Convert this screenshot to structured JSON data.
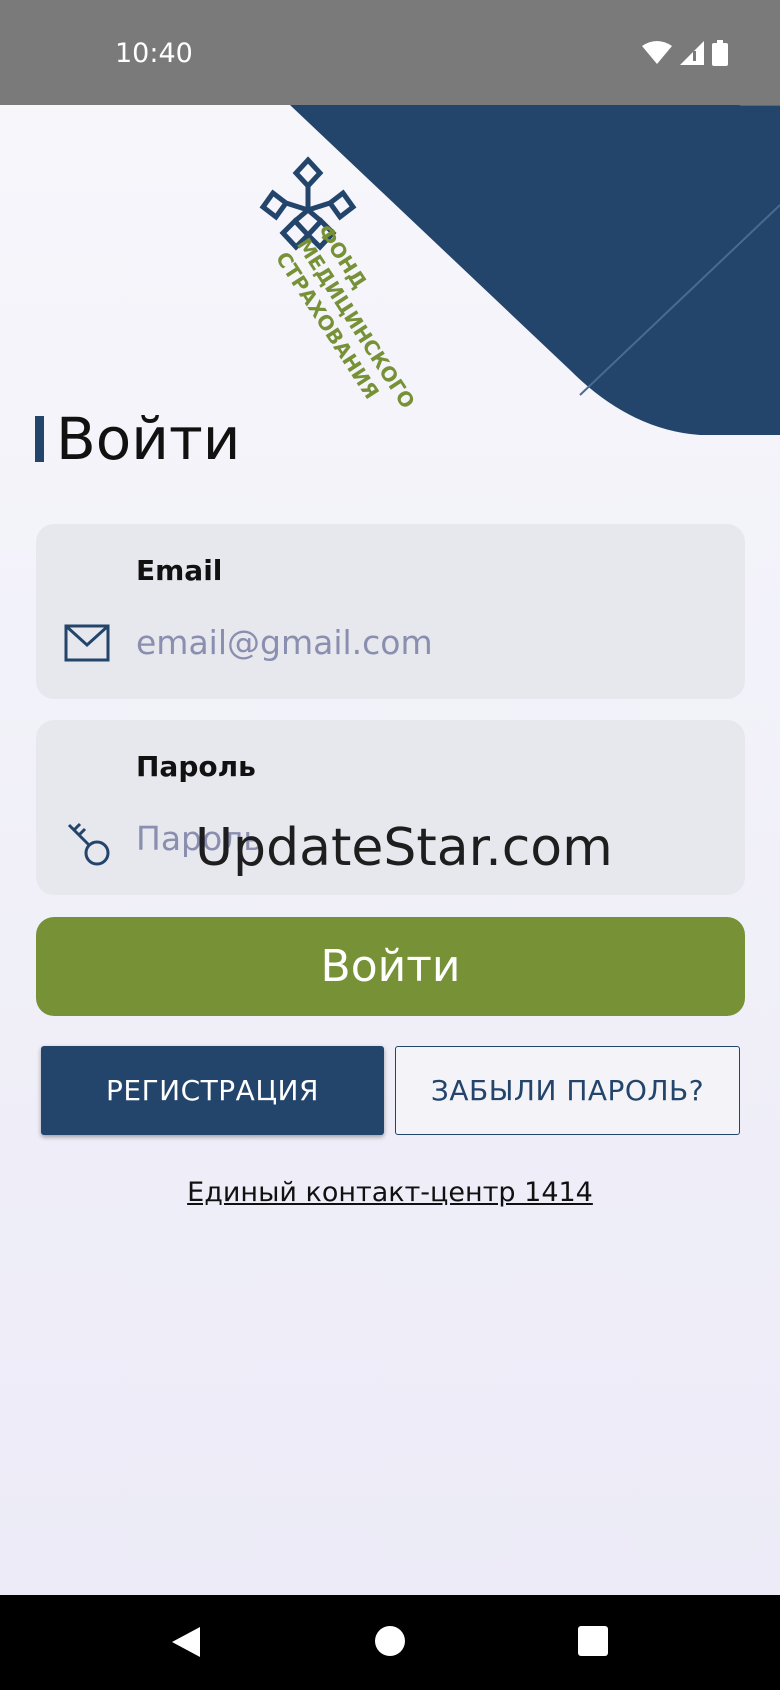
{
  "status_bar": {
    "time": "10:40",
    "icons": [
      "wifi-icon",
      "signal-icon",
      "battery-icon"
    ]
  },
  "logo": {
    "lines": [
      "ФОНД",
      "МЕДИЦИНСКОГО",
      "СТРАХОВАНИЯ"
    ],
    "colors": {
      "mark": "#23456b",
      "text": "#779136"
    }
  },
  "page": {
    "title": "Войти"
  },
  "email_field": {
    "label": "Email",
    "placeholder": "email@gmail.com",
    "value": "",
    "icon": "mail-icon"
  },
  "password_field": {
    "label": "Пароль",
    "placeholder": "Пароль",
    "value": "",
    "icon": "key-icon"
  },
  "watermark": "UpdateStar.com",
  "buttons": {
    "login": "Войти",
    "register": "РЕГИСТРАЦИЯ",
    "forgot": "ЗАБЫЛИ ПАРОЛЬ?"
  },
  "contact_link": "Единый контакт-центр 1414",
  "colors": {
    "primary_navy": "#23456b",
    "accent_green": "#779136",
    "field_bg": "#e7e7ee",
    "placeholder": "#8a8fb0"
  },
  "nav_bar": {
    "icons": [
      "back-icon",
      "home-icon",
      "recents-icon"
    ]
  }
}
